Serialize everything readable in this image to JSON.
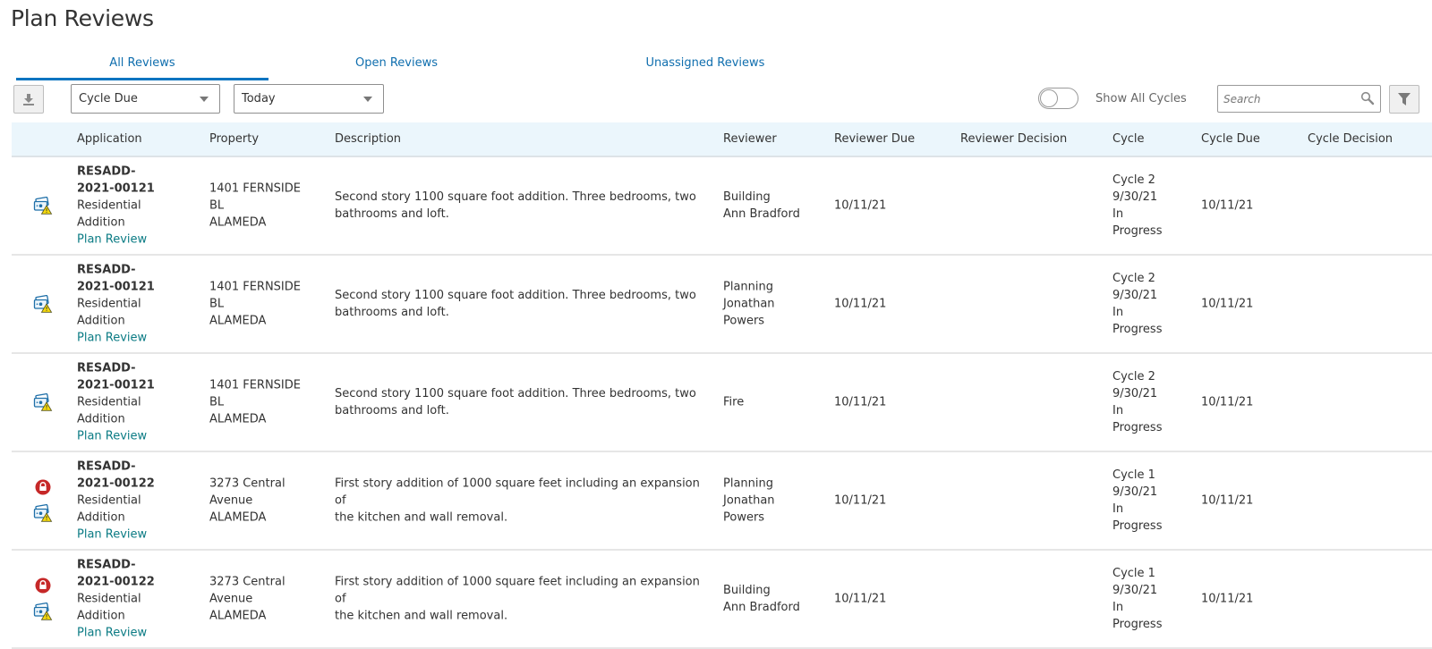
{
  "page": {
    "title": "Plan Reviews"
  },
  "tabs": [
    {
      "label": "All Reviews",
      "active": true
    },
    {
      "label": "Open Reviews",
      "active": false
    },
    {
      "label": "Unassigned Reviews",
      "active": false
    }
  ],
  "toolbar": {
    "download_icon": "download-icon",
    "date_field_select": {
      "value": "Cycle Due"
    },
    "date_range_select": {
      "value": "Today"
    },
    "show_all_cycles": {
      "label": "Show All Cycles",
      "on": false
    },
    "search": {
      "placeholder": "Search",
      "value": ""
    },
    "filter_icon": "filter-icon"
  },
  "colors": {
    "accent": "#0a74c0",
    "link": "#0b7b84",
    "header_bg": "#ebf6fc",
    "lock_red": "#c62828",
    "warning_yellow": "#f5d90a"
  },
  "table": {
    "columns": [
      "Application",
      "Property",
      "Description",
      "Reviewer",
      "Reviewer Due",
      "Reviewer Decision",
      "Cycle",
      "Cycle Due",
      "Cycle Decision"
    ],
    "rows": [
      {
        "locked": false,
        "app_id_1": "RESADD-",
        "app_id_2": "2021-00121",
        "app_type_1": "Residential",
        "app_type_2": "Addition",
        "app_link": "Plan Review",
        "prop_1": "1401 FERNSIDE",
        "prop_2": "BL",
        "prop_3": "ALAMEDA",
        "desc_1": "Second story 1100 square foot addition. Three bedrooms, two",
        "desc_2": "bathrooms and loft.",
        "rev_1": "Building",
        "rev_2": "Ann Bradford",
        "rev_3": "",
        "reviewer_due": "10/11/21",
        "reviewer_decision": "",
        "cycle_1": "Cycle 2",
        "cycle_2": "9/30/21",
        "cycle_3": "In",
        "cycle_4": "Progress",
        "cycle_due": "10/11/21",
        "cycle_decision": ""
      },
      {
        "locked": false,
        "app_id_1": "RESADD-",
        "app_id_2": "2021-00121",
        "app_type_1": "Residential",
        "app_type_2": "Addition",
        "app_link": "Plan Review",
        "prop_1": "1401 FERNSIDE",
        "prop_2": "BL",
        "prop_3": "ALAMEDA",
        "desc_1": "Second story 1100 square foot addition. Three bedrooms, two",
        "desc_2": "bathrooms and loft.",
        "rev_1": "Planning",
        "rev_2": "Jonathan",
        "rev_3": "Powers",
        "reviewer_due": "10/11/21",
        "reviewer_decision": "",
        "cycle_1": "Cycle 2",
        "cycle_2": "9/30/21",
        "cycle_3": "In",
        "cycle_4": "Progress",
        "cycle_due": "10/11/21",
        "cycle_decision": ""
      },
      {
        "locked": false,
        "app_id_1": "RESADD-",
        "app_id_2": "2021-00121",
        "app_type_1": "Residential",
        "app_type_2": "Addition",
        "app_link": "Plan Review",
        "prop_1": "1401 FERNSIDE",
        "prop_2": "BL",
        "prop_3": "ALAMEDA",
        "desc_1": "Second story 1100 square foot addition. Three bedrooms, two",
        "desc_2": "bathrooms and loft.",
        "rev_1": "Fire",
        "rev_2": "",
        "rev_3": "",
        "reviewer_due": "10/11/21",
        "reviewer_decision": "",
        "cycle_1": "Cycle 2",
        "cycle_2": "9/30/21",
        "cycle_3": "In",
        "cycle_4": "Progress",
        "cycle_due": "10/11/21",
        "cycle_decision": ""
      },
      {
        "locked": true,
        "app_id_1": "RESADD-",
        "app_id_2": "2021-00122",
        "app_type_1": "Residential",
        "app_type_2": "Addition",
        "app_link": "Plan Review",
        "prop_1": "3273 Central",
        "prop_2": "Avenue",
        "prop_3": "ALAMEDA",
        "desc_1": "First story addition of 1000 square feet including an expansion of",
        "desc_2": "the kitchen and wall removal.",
        "rev_1": "Planning",
        "rev_2": "Jonathan",
        "rev_3": "Powers",
        "reviewer_due": "10/11/21",
        "reviewer_decision": "",
        "cycle_1": "Cycle 1",
        "cycle_2": "9/30/21",
        "cycle_3": "In",
        "cycle_4": "Progress",
        "cycle_due": "10/11/21",
        "cycle_decision": ""
      },
      {
        "locked": true,
        "app_id_1": "RESADD-",
        "app_id_2": "2021-00122",
        "app_type_1": "Residential",
        "app_type_2": "Addition",
        "app_link": "Plan Review",
        "prop_1": "3273 Central",
        "prop_2": "Avenue",
        "prop_3": "ALAMEDA",
        "desc_1": "First story addition of 1000 square feet including an expansion of",
        "desc_2": "the kitchen and wall removal.",
        "rev_1": "Building",
        "rev_2": "Ann Bradford",
        "rev_3": "",
        "reviewer_due": "10/11/21",
        "reviewer_decision": "",
        "cycle_1": "Cycle 1",
        "cycle_2": "9/30/21",
        "cycle_3": "In",
        "cycle_4": "Progress",
        "cycle_due": "10/11/21",
        "cycle_decision": ""
      }
    ]
  }
}
